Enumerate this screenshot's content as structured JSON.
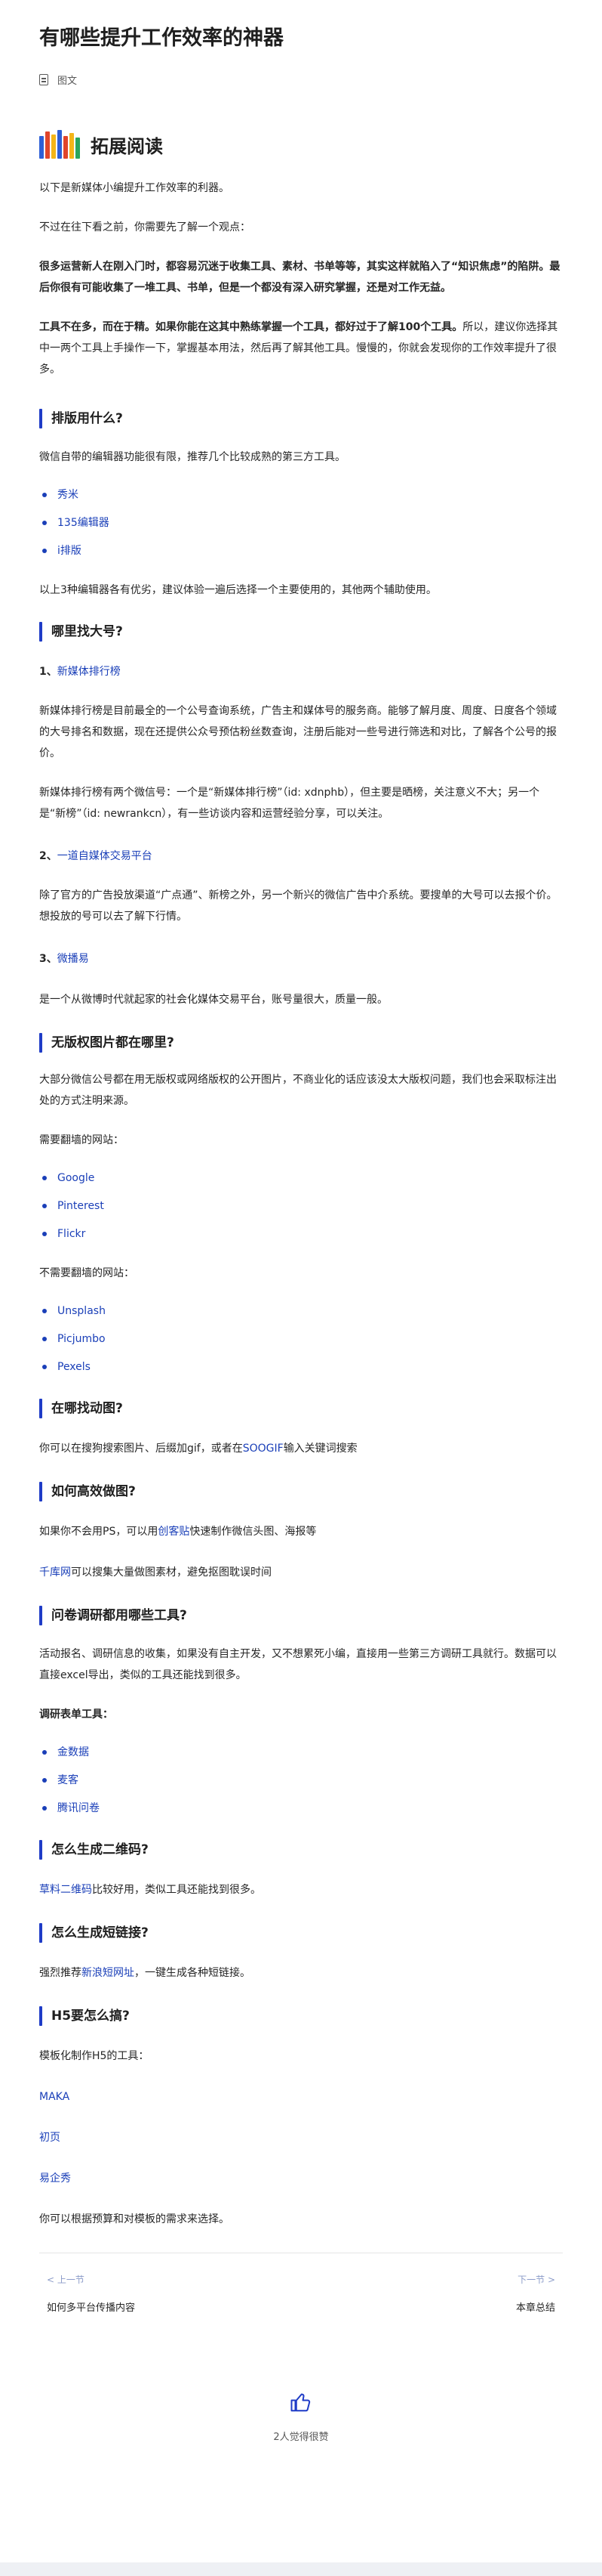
{
  "title": "有哪些提升工作效率的神器",
  "meta": {
    "category": "图文"
  },
  "banner": {
    "text": "拓展阅读",
    "book_colors": [
      "#2e5fd6",
      "#e0442b",
      "#f4b518",
      "#2e5fd6",
      "#e0442b",
      "#f4b518",
      "#2aa55d"
    ]
  },
  "intro": {
    "p1": "以下是新媒体小编提升工作效率的利器。",
    "p2": "不过在往下看之前，你需要先了解一个观点：",
    "p3": "很多运营新人在刚入门时，都容易沉迷于收集工具、素材、书单等等，其实这样就陷入了“知识焦虑”的陷阱。最后你很有可能收集了一堆工具、书单，但是一个都没有深入研究掌握，还是对工作无益。",
    "p4_bold": "工具不在多，而在于精。如果你能在这其中熟练掌握一个工具，都好过于了解100个工具。",
    "p4_rest": "所以，建议你选择其中一两个工具上手操作一下，掌握基本用法，然后再了解其他工具。慢慢的，你就会发现你的工作效率提升了很多。"
  },
  "s1": {
    "heading": "排版用什么?",
    "desc": "微信自带的编辑器功能很有限，推荐几个比较成熟的第三方工具。",
    "items": [
      "秀米",
      "135编辑器",
      "i排版"
    ],
    "note": "以上3种编辑器各有优劣，建议体验一遍后选择一个主要使用的，其他两个辅助使用。"
  },
  "s2": {
    "heading": "哪里找大号?",
    "item1_num": "1、",
    "item1_link": "新媒体排行榜",
    "item1_p1": "新媒体排行榜是目前最全的一个公号查询系统，广告主和媒体号的服务商。能够了解月度、周度、日度各个领域的大号排名和数据，现在还提供公众号预估粉丝数查询，注册后能对一些号进行筛选和对比，了解各个公号的报价。",
    "item1_p2": "新媒体排行榜有两个微信号：一个是“新媒体排行榜”（id: xdnphb），但主要是晒榜，关注意义不大；另一个是“新榜”（id: newrankcn），有一些访谈内容和运营经验分享，可以关注。",
    "item2_num": "2、",
    "item2_link": "一道自媒体交易平台",
    "item2_p": "除了官方的广告投放渠道“广点通”、新榜之外，另一个新兴的微信广告中介系统。要搜单的大号可以去报个价。想投放的号可以去了解下行情。",
    "item3_num": "3、",
    "item3_link": "微播易",
    "item3_p": "是一个从微博时代就起家的社会化媒体交易平台，账号量很大，质量一般。"
  },
  "s3": {
    "heading": "无版权图片都在哪里?",
    "desc": "大部分微信公号都在用无版权或网络版权的公开图片，不商业化的话应该没太大版权问题，我们也会采取标注出处的方式注明来源。",
    "wall_label": "需要翻墙的网站：",
    "wall_items": [
      "Google",
      "Pinterest",
      "Flickr"
    ],
    "nowall_label": "不需要翻墙的网站：",
    "nowall_items": [
      "Unsplash",
      "Picjumbo",
      "Pexels"
    ]
  },
  "s4": {
    "heading": "在哪找动图?",
    "text_before": "你可以在搜狗搜索图片、后缀加gif，或者在",
    "link": "SOOGIF",
    "text_after": "输入关键词搜索"
  },
  "s5": {
    "heading": "如何高效做图?",
    "p1_before": "如果你不会用PS，可以用",
    "p1_link": "创客贴",
    "p1_after": "快速制作微信头图、海报等",
    "p2_link": "千库网",
    "p2_after": "可以搜集大量做图素材，避免抠图耽误时间"
  },
  "s6": {
    "heading": "问卷调研都用哪些工具?",
    "desc": "活动报名、调研信息的收集，如果没有自主开发，又不想累死小编，直接用一些第三方调研工具就行。数据可以直接excel导出，类似的工具还能找到很多。",
    "label": "调研表单工具：",
    "items": [
      "金数据",
      "麦客",
      "腾讯问卷"
    ]
  },
  "s7": {
    "heading": "怎么生成二维码?",
    "link": "草料二维码",
    "after": "比较好用，类似工具还能找到很多。"
  },
  "s8": {
    "heading": "怎么生成短链接?",
    "before": "强烈推荐",
    "link": "新浪短网址",
    "after": "，一键生成各种短链接。"
  },
  "s9": {
    "heading": "H5要怎么搞?",
    "label": "模板化制作H5的工具：",
    "items": [
      "MAKA",
      "初页",
      "易企秀"
    ],
    "note": "你可以根据预算和对模板的需求来选择。"
  },
  "nav": {
    "prev_dir": "< 上一节",
    "prev_title": "如何多平台传播内容",
    "next_dir": "下一节 >",
    "next_title": "本章总结"
  },
  "like": {
    "label": "2人觉得很赞"
  },
  "colors": {
    "accent": "#1f3cc7",
    "link": "#1a3fb8"
  }
}
